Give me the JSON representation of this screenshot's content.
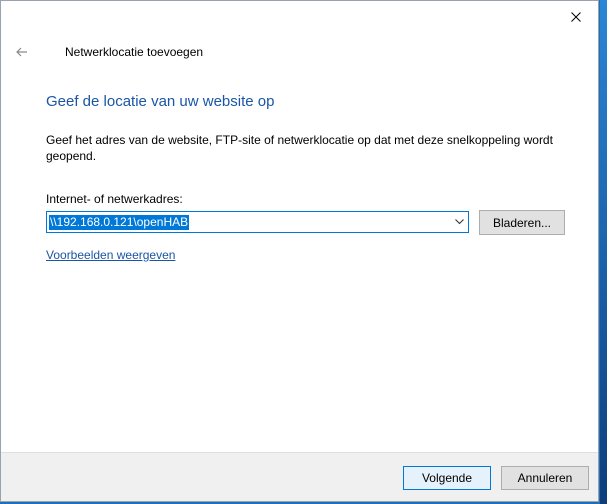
{
  "window": {
    "title": "Netwerklocatie toevoegen",
    "close_icon": "close-icon",
    "back_icon": "arrow-left-icon"
  },
  "main": {
    "heading": "Geef de locatie van uw website op",
    "description": "Geef het adres van de website, FTP-site of netwerklocatie op dat met deze snelkoppeling wordt geopend.",
    "address_label": "Internet- of netwerkadres:",
    "address_value": "\\\\192.168.0.121\\openHAB",
    "browse_label": "Bladeren...",
    "examples_link": "Voorbeelden weergeven"
  },
  "footer": {
    "next_label": "Volgende",
    "cancel_label": "Annuleren"
  },
  "colors": {
    "accent": "#0078d7",
    "heading": "#1a55a6",
    "desktop": "#1f6fb8"
  }
}
